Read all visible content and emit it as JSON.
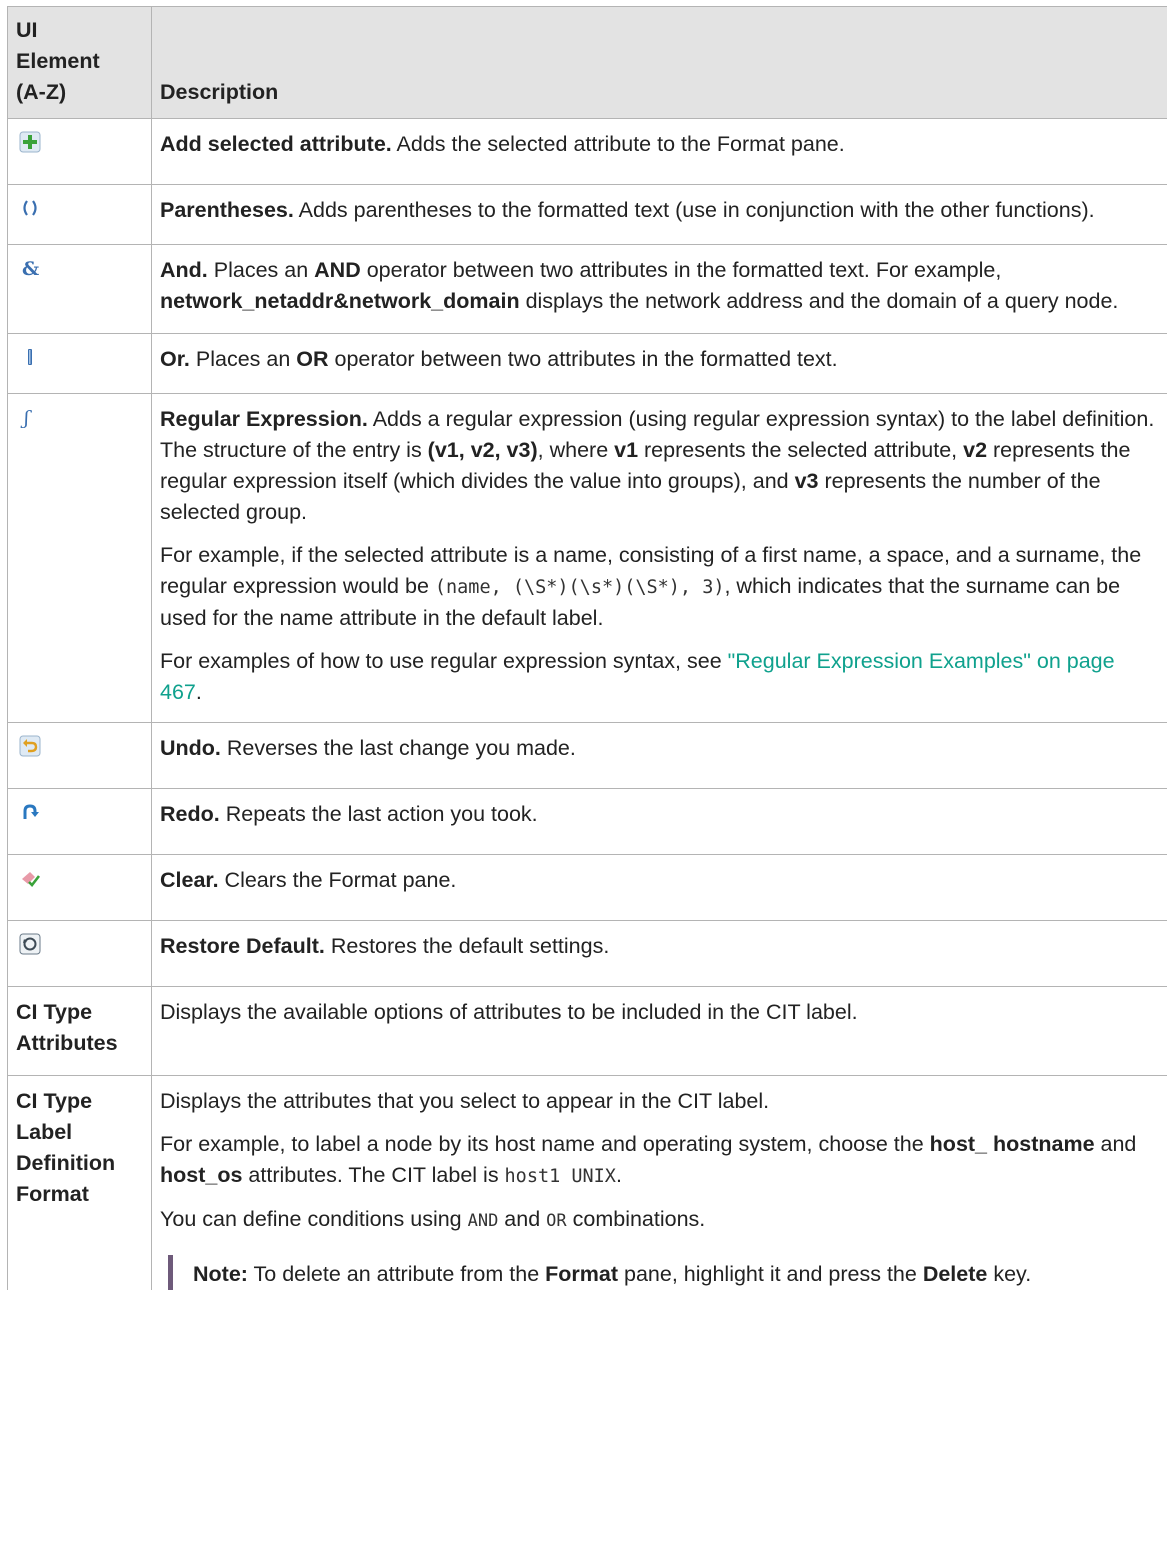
{
  "table": {
    "header": {
      "col1": "UI Element (A-Z)",
      "col1_lines": [
        "UI",
        "Element",
        "(A-Z)"
      ],
      "col2": "Description"
    },
    "rows": {
      "add": {
        "icon": "add-attribute-icon",
        "title": "Add selected attribute.",
        "text": " Adds the selected attribute to the Format pane."
      },
      "paren": {
        "icon": "parentheses-icon",
        "title": "Parentheses.",
        "text": " Adds parentheses to the formatted text (use in conjunction with the other functions)."
      },
      "and": {
        "icon": "and-operator-icon",
        "title": "And.",
        "t1": " Places an ",
        "b1": "AND",
        "t2": " operator between two attributes in the formatted text. For example, ",
        "b2": "network_netaddr&network_domain",
        "t3": " displays the network address and the domain of a query node."
      },
      "or": {
        "icon": "or-operator-icon",
        "title": "Or.",
        "t1": " Places an ",
        "b1": "OR",
        "t2": " operator between two attributes in the formatted text."
      },
      "regex": {
        "icon": "regular-expression-icon",
        "title": "Regular Expression.",
        "p1_t1": " Adds a regular expression (using regular expression syntax) to the label definition. The structure of the entry is ",
        "p1_b1": "(v1, v2, v3)",
        "p1_t2": ", where ",
        "p1_b2": "v1",
        "p1_t3": " represents the selected attribute, ",
        "p1_b3": "v2",
        "p1_t4": " represents the regular expression itself (which divides the value into groups), and ",
        "p1_b4": "v3",
        "p1_t5": " represents the number of the selected group.",
        "p2_t1": "For example, if the selected attribute is a name, consisting of a first name, a space, and a surname, the regular expression would be ",
        "p2_code": "(name, (\\S*)(\\s*)(\\S*), 3)",
        "p2_t2": ", which indicates that the surname can be used for the name attribute in the default label.",
        "p3_t1": "For examples of how to use regular expression syntax, see ",
        "p3_link": "\"Regular Expression Examples\" on page 467",
        "p3_t2": "."
      },
      "undo": {
        "icon": "undo-icon",
        "title": "Undo.",
        "text": " Reverses the last change you made."
      },
      "redo": {
        "icon": "redo-icon",
        "title": "Redo.",
        "text": " Repeats the last action you took."
      },
      "clear": {
        "icon": "clear-icon",
        "title": "Clear.",
        "text": " Clears the Format pane."
      },
      "restore": {
        "icon": "restore-default-icon",
        "title": "Restore Default.",
        "text": " Restores the default settings."
      },
      "cit_attrs": {
        "name": "CI Type Attributes",
        "name_lines": [
          "CI Type",
          "Attributes"
        ],
        "text": "Displays the available options of attributes to be included in the CIT label."
      },
      "cit_format": {
        "name": "CI Type Label Definition Format",
        "name_lines": [
          "CI Type",
          "Label",
          "Definition",
          "Format"
        ],
        "p1": "Displays the attributes that you select to appear in the CIT label.",
        "p2_t1": "For example, to label a node by its host name and operating system, choose the ",
        "p2_b1": "host_ hostname",
        "p2_t2": " and ",
        "p2_b2": "host_os",
        "p2_t3": " attributes. The CIT label is ",
        "p2_code": "host1 UNIX",
        "p2_t4": ".",
        "p3_t1": "You can define conditions using ",
        "p3_c1": "AND",
        "p3_t2": " and ",
        "p3_c2": "OR",
        "p3_t3": " combinations.",
        "note_label": "Note:",
        "note_t1": " To delete an attribute from the ",
        "note_b1": "Format",
        "note_t2": " pane, highlight it and press the ",
        "note_b2": "Delete",
        "note_t3": " key."
      }
    }
  },
  "colors": {
    "header_bg": "#e3e3e3",
    "border": "#b4b4b4",
    "link": "#0fa18d",
    "note_bar": "#6e5a7a",
    "icon_green": "#3aa23a",
    "icon_blue": "#3a6fb0"
  }
}
